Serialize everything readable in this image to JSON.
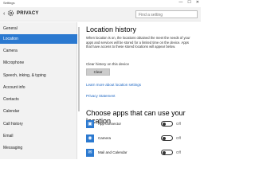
{
  "window": {
    "title": "Settings",
    "controls": [
      "—",
      "☐",
      "✕"
    ]
  },
  "header": {
    "section": "PRIVACY",
    "search_placeholder": "Find a setting"
  },
  "sidebar": {
    "items": [
      {
        "label": "General"
      },
      {
        "label": "Location",
        "active": true
      },
      {
        "label": "Camera"
      },
      {
        "label": "Microphone"
      },
      {
        "label": "Speech, inking, & typing"
      },
      {
        "label": "Account info"
      },
      {
        "label": "Contacts"
      },
      {
        "label": "Calendar"
      },
      {
        "label": "Call history"
      },
      {
        "label": "Email"
      },
      {
        "label": "Messaging"
      }
    ]
  },
  "main": {
    "title": "Location history",
    "description": "When location is on, the locations obtained the meet the needs of your apps and services will be stored for a limited time on the device. Apps that have access to these stored locations will appear below.",
    "clear_label": "Clear history on this device",
    "clear_button": "Clear",
    "link_learn": "Learn more about location settings",
    "link_privacy": "Privacy Statement",
    "apps_heading": "Choose apps that can use your location",
    "apps": [
      {
        "name": "App connector",
        "state": "Off"
      },
      {
        "name": "Camera",
        "state": "Off"
      },
      {
        "name": "Mail and Calendar",
        "state": "Off"
      }
    ]
  },
  "colors": {
    "accent": "#2b79d0",
    "sidebar_bg": "#f2f2f2",
    "link": "#1a64c2"
  }
}
